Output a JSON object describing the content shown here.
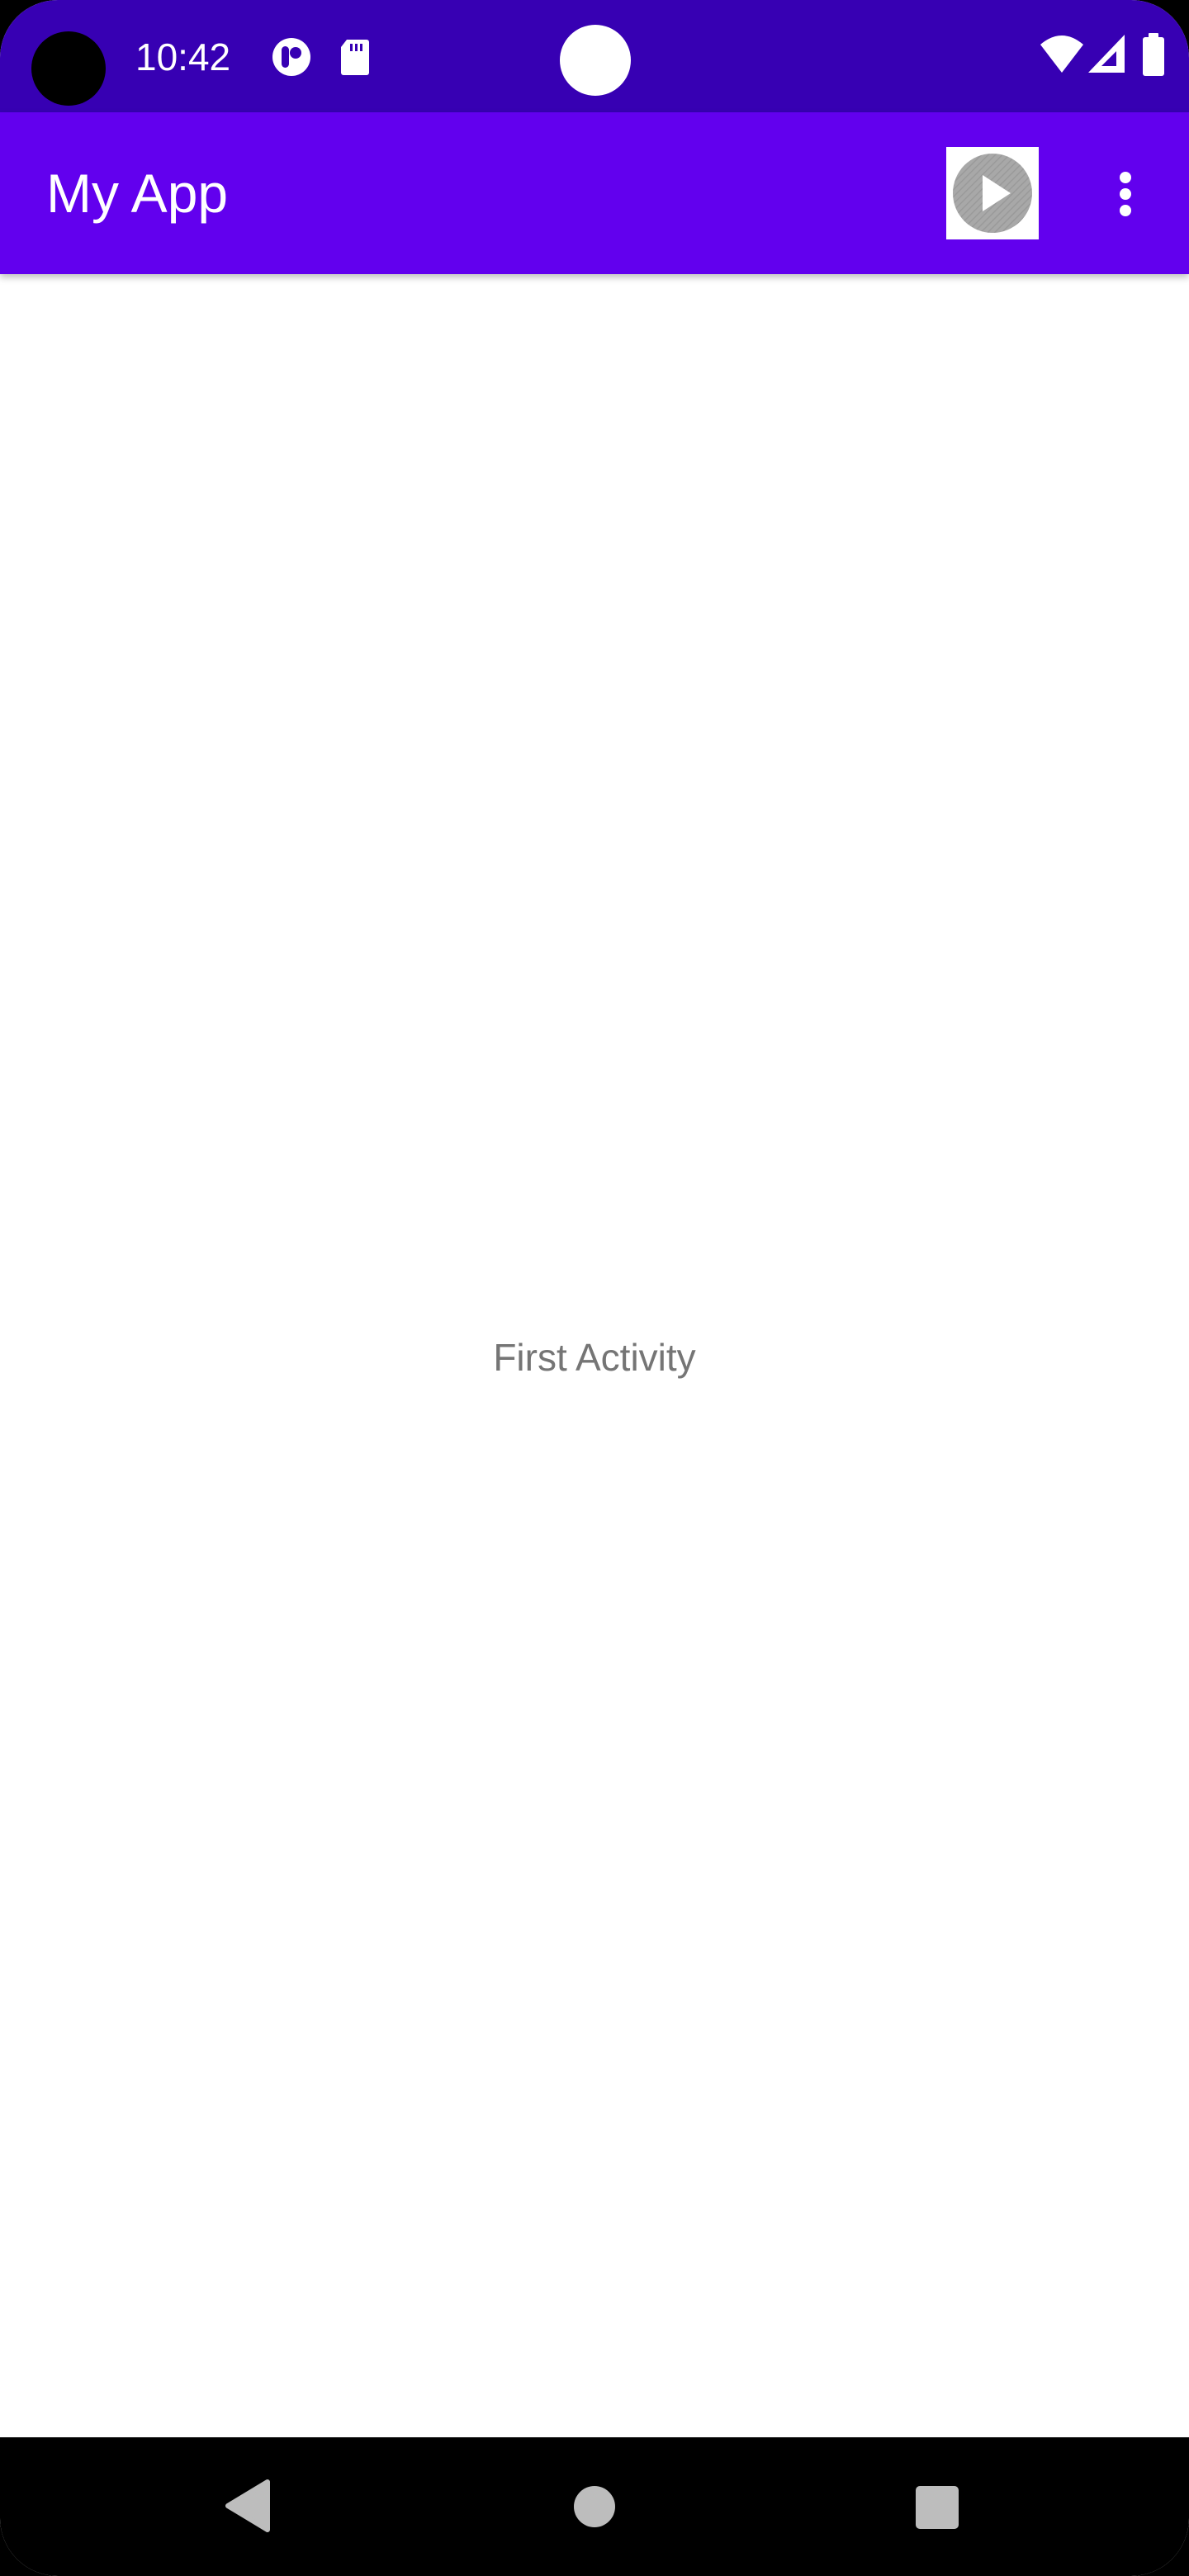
{
  "status_bar": {
    "time": "10:42",
    "background_color": "#3700B3",
    "left_icons": [
      "camera-hole",
      "app-notification-icon",
      "sd-card-icon"
    ],
    "right_icons": [
      "wifi-icon",
      "cellular-signal-icon",
      "battery-icon"
    ]
  },
  "app_bar": {
    "title": "My App",
    "background_color": "#6200EE",
    "actions": [
      {
        "name": "play-icon",
        "type": "icon-button"
      },
      {
        "name": "more-vert-icon",
        "type": "overflow-menu"
      }
    ]
  },
  "content": {
    "text": "First Activity",
    "background_color": "#FFFFFF"
  },
  "nav_bar": {
    "background_color": "#000000",
    "buttons": [
      "back-icon",
      "home-icon",
      "recents-icon"
    ]
  }
}
